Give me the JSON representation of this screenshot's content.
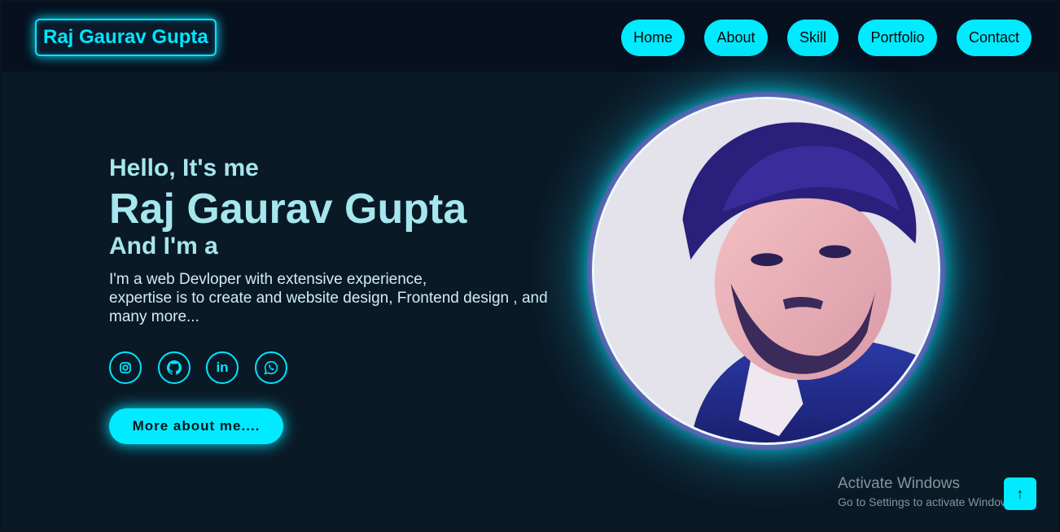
{
  "header": {
    "brand": "Raj Gaurav Gupta",
    "nav": [
      {
        "label": "Home"
      },
      {
        "label": "About"
      },
      {
        "label": "Skill"
      },
      {
        "label": "Portfolio"
      },
      {
        "label": "Contact"
      }
    ]
  },
  "hero": {
    "greeting": "Hello, It's me",
    "name": "Raj Gaurav Gupta",
    "role_prefix": "And I'm a",
    "description_lines": [
      "I'm a web Devloper with extensive experience,",
      "expertise is to create and website design, Frontend design , and",
      "many more..."
    ],
    "social": [
      {
        "icon": "instagram-icon"
      },
      {
        "icon": "github-icon"
      },
      {
        "icon": "linkedin-icon"
      },
      {
        "icon": "whatsapp-icon"
      }
    ],
    "cta_label": "More about me...."
  },
  "watermark": {
    "title": "Activate Windows",
    "subtitle": "Go to Settings to activate Windows."
  },
  "colors": {
    "accent": "#00ebff",
    "background": "#0a1926",
    "header_bg": "#06101f",
    "text": "#a6e6ee"
  }
}
